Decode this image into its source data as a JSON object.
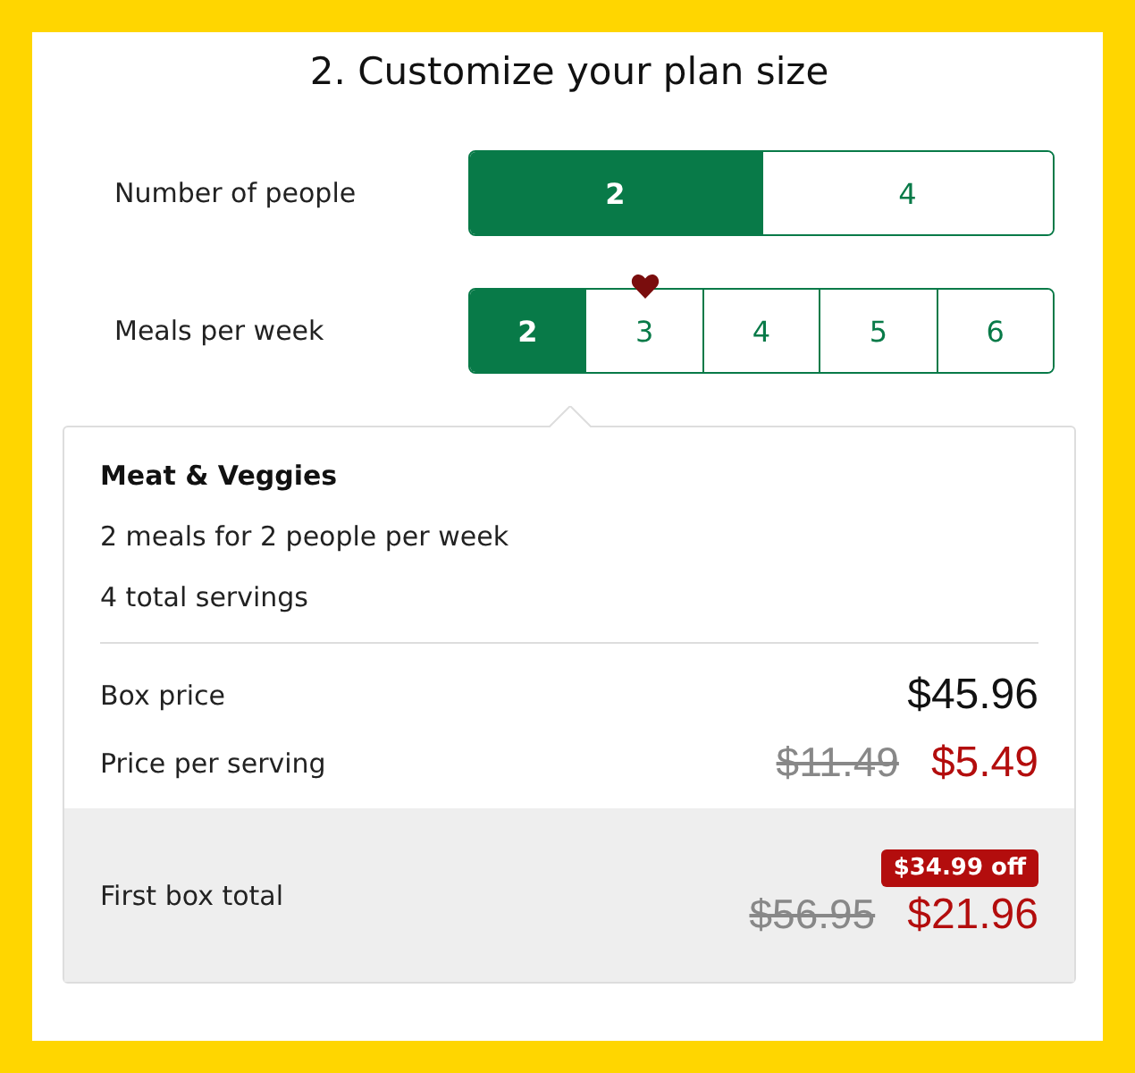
{
  "title": "2. Customize your plan size",
  "options": [
    {
      "label": "Number of people",
      "choices": [
        {
          "value": "2",
          "selected": true,
          "recommended": false
        },
        {
          "value": "4",
          "selected": false,
          "recommended": false
        }
      ]
    },
    {
      "label": "Meals per week",
      "choices": [
        {
          "value": "2",
          "selected": true,
          "recommended": false
        },
        {
          "value": "3",
          "selected": false,
          "recommended": true
        },
        {
          "value": "4",
          "selected": false,
          "recommended": false
        },
        {
          "value": "5",
          "selected": false,
          "recommended": false
        },
        {
          "value": "6",
          "selected": false,
          "recommended": false
        }
      ]
    }
  ],
  "summary": {
    "plan": "Meat & Veggies",
    "details": [
      "2 meals for 2 people per week",
      "4 total servings"
    ],
    "prices": [
      {
        "label": "Box price",
        "price": "$45.96"
      },
      {
        "label": "Price per serving",
        "original": "$11.49",
        "price": "$5.49"
      }
    ],
    "total": {
      "label": "First box total",
      "badge": "$34.99 off",
      "original": "$56.95",
      "price": "$21.96"
    }
  }
}
